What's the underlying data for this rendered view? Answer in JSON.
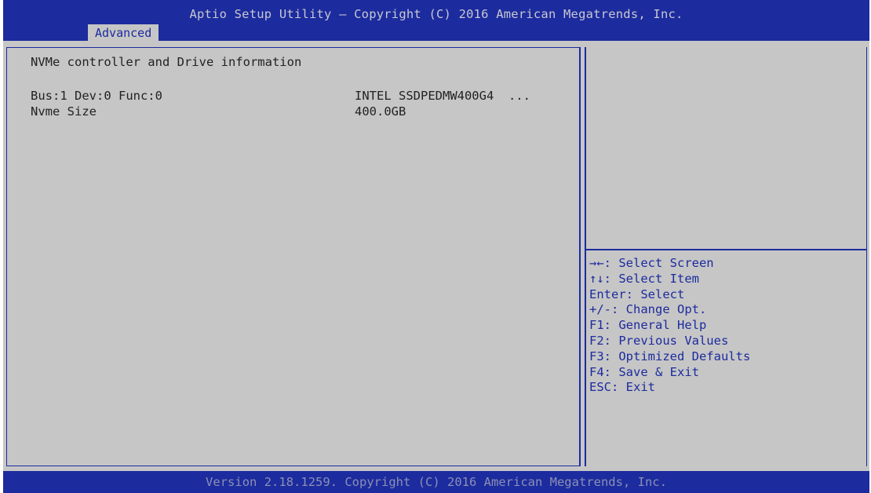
{
  "header": {
    "title": "Aptio Setup Utility – Copyright (C) 2016 American Megatrends, Inc.",
    "active_tab": "Advanced"
  },
  "main": {
    "section_title": "NVMe controller and Drive information",
    "rows": [
      {
        "label": "Bus:1 Dev:0 Func:0",
        "value": "INTEL SSDPEDMW400G4  ..."
      },
      {
        "label": "Nvme Size",
        "value": "400.0GB"
      }
    ]
  },
  "help": {
    "items": [
      "→←: Select Screen",
      "↑↓: Select Item",
      "Enter: Select",
      "+/-: Change Opt.",
      "F1: General Help",
      "F2: Previous Values",
      "F3: Optimized Defaults",
      "F4: Save & Exit",
      "ESC: Exit"
    ]
  },
  "footer": {
    "text": "Version 2.18.1259. Copyright (C) 2016 American Megatrends, Inc."
  },
  "colors": {
    "bios_blue": "#1c2b9e",
    "panel_gray": "#c6c6c6",
    "text_dark": "#222222",
    "header_text": "#c8c8d0",
    "footer_text": "#8c90b4"
  }
}
